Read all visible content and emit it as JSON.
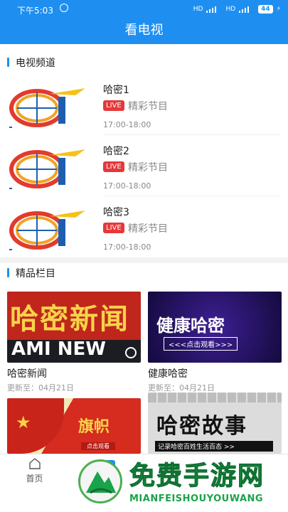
{
  "status_bar": {
    "time": "下午5:03",
    "battery": "44",
    "net1": "HD",
    "net2": "HD"
  },
  "header": {
    "title": "看电视"
  },
  "sections": {
    "channels_title": "电视频道",
    "programs_title": "精品栏目"
  },
  "channels": [
    {
      "name": "哈密1",
      "live": "LIVE",
      "program": "精彩节目",
      "time": "17:00-18:00"
    },
    {
      "name": "哈密2",
      "live": "LIVE",
      "program": "精彩节目",
      "time": "17:00-18:00"
    },
    {
      "name": "哈密3",
      "live": "LIVE",
      "program": "精彩节目",
      "time": "17:00-18:00"
    }
  ],
  "programs": [
    {
      "title": "哈密新闻",
      "update": "更新至：04月21日",
      "thumb_text": "哈密新闻",
      "thumb_sub": "AMI NEW"
    },
    {
      "title": "健康哈密",
      "update": "更新至：04月21日",
      "thumb_text": "健康哈密",
      "thumb_sub": "<<<点击观看>>>"
    },
    {
      "title": "",
      "update": "",
      "thumb_text": "旗帜",
      "thumb_sub": "点击观看"
    },
    {
      "title": "",
      "update": "",
      "thumb_text": "哈密故事",
      "thumb_sub": "记录哈密百姓生活百态 >>"
    }
  ],
  "tabs": [
    {
      "label": "首页",
      "icon": "home-icon"
    }
  ],
  "overlay": {
    "title": "免费手游网",
    "subtitle": "MIANFEISHOUYOUWANG"
  },
  "colors": {
    "accent": "#1e8ff0",
    "live": "#e5383b",
    "watermark": "#1aa34a"
  }
}
